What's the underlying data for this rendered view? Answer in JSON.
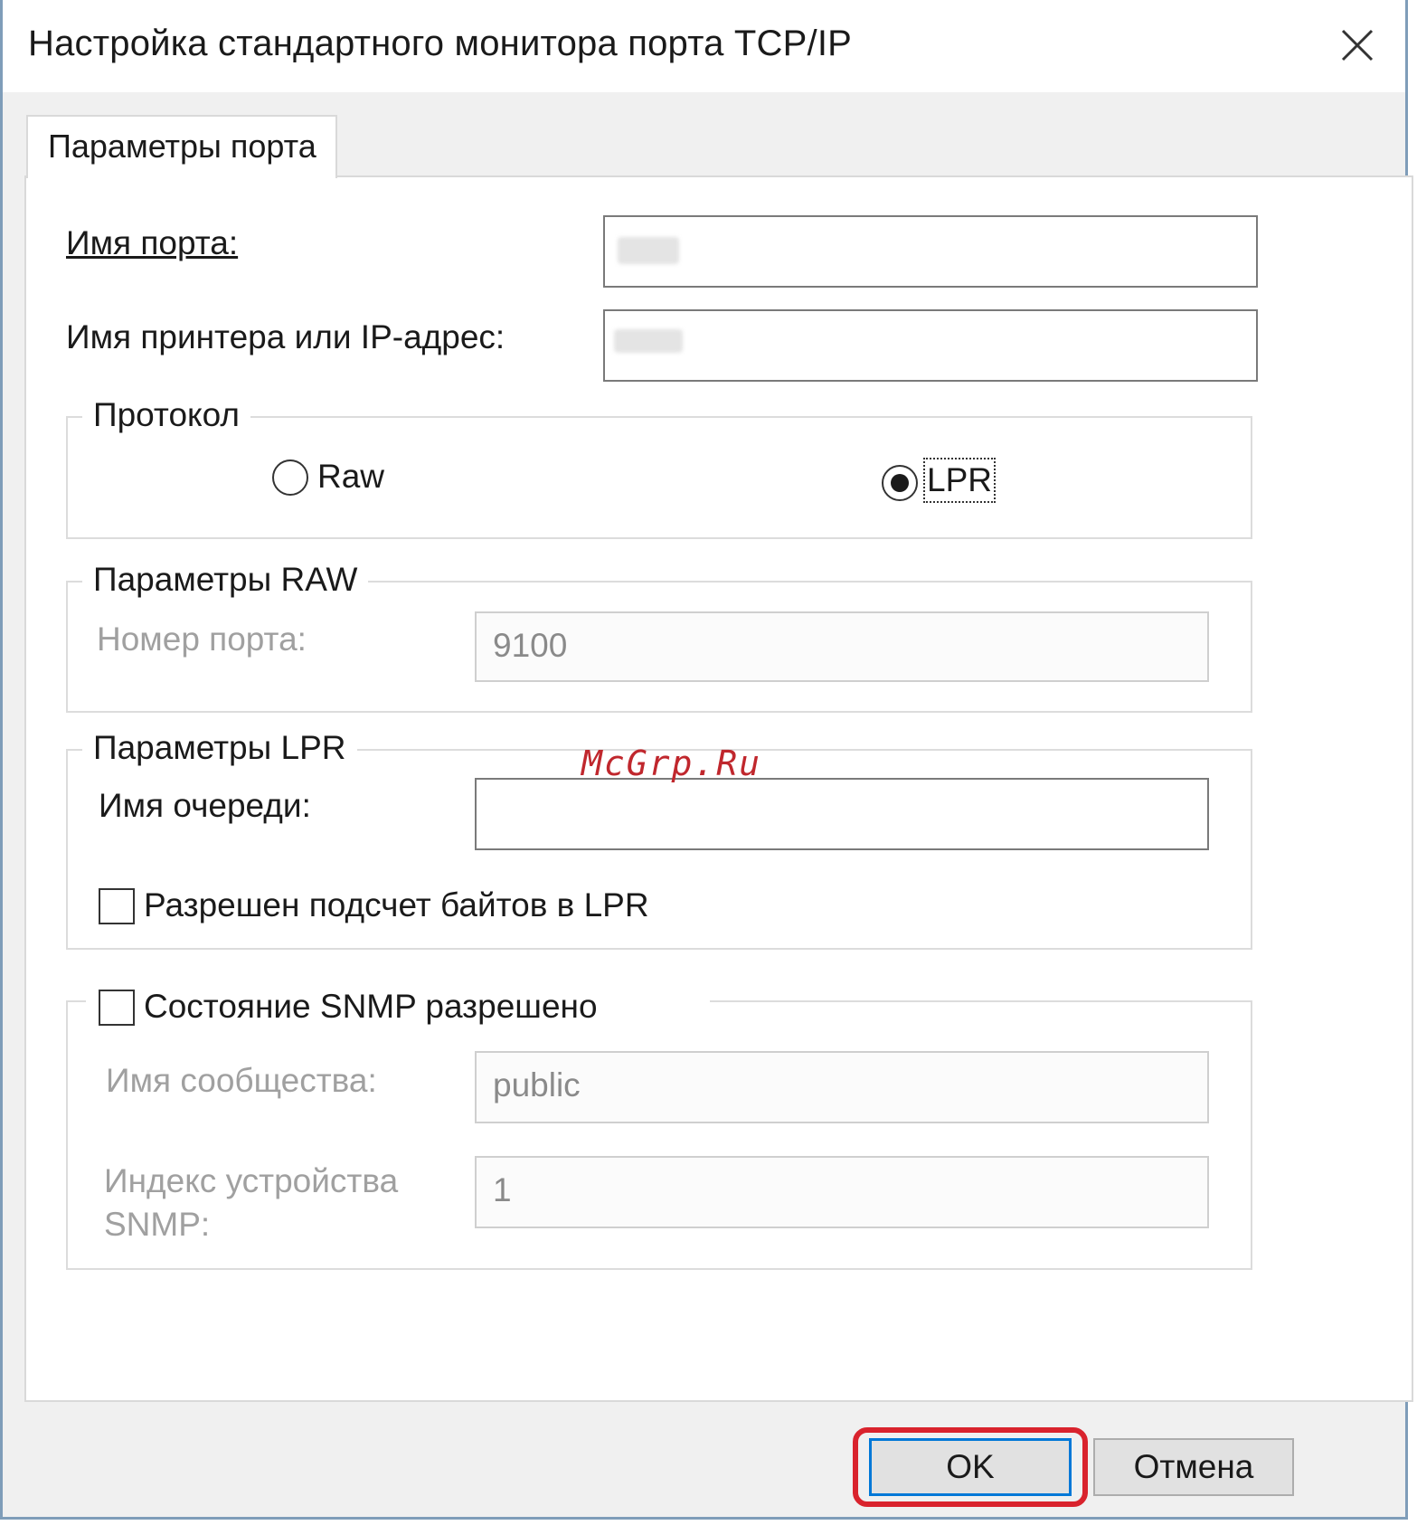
{
  "window": {
    "title": "Настройка стандартного монитора порта TCP/IP",
    "close_icon": "close-icon"
  },
  "tabs": [
    {
      "label": "Параметры порта",
      "selected": true
    }
  ],
  "fields": {
    "port_name": {
      "label": "Имя порта:",
      "value": ""
    },
    "printer_ip": {
      "label": "Имя принтера или IP-адрес:",
      "value": ""
    }
  },
  "protocol": {
    "title": "Протокол",
    "options": [
      {
        "label": "Raw",
        "selected": false
      },
      {
        "label": "LPR",
        "selected": true
      }
    ]
  },
  "raw_settings": {
    "title": "Параметры RAW",
    "port_number_label": "Номер порта:",
    "port_number_value": "9100"
  },
  "lpr_settings": {
    "title": "Параметры LPR",
    "queue_name_label": "Имя очереди:",
    "queue_name_value": "",
    "byte_count_label": "Разрешен подсчет байтов в LPR",
    "byte_count_checked": false
  },
  "snmp": {
    "enabled_label": "Состояние SNMP разрешено",
    "enabled_checked": false,
    "community_label": "Имя сообщества:",
    "community_value": "public",
    "device_index_label": "Индекс устройства SNMP:",
    "device_index_value": "1"
  },
  "buttons": {
    "ok": "OK",
    "cancel": "Отмена"
  },
  "watermark": "McGrp.Ru",
  "colors": {
    "highlight": "#d9232d",
    "default_button_border": "#0078d7",
    "watermark": "#c0272d"
  }
}
